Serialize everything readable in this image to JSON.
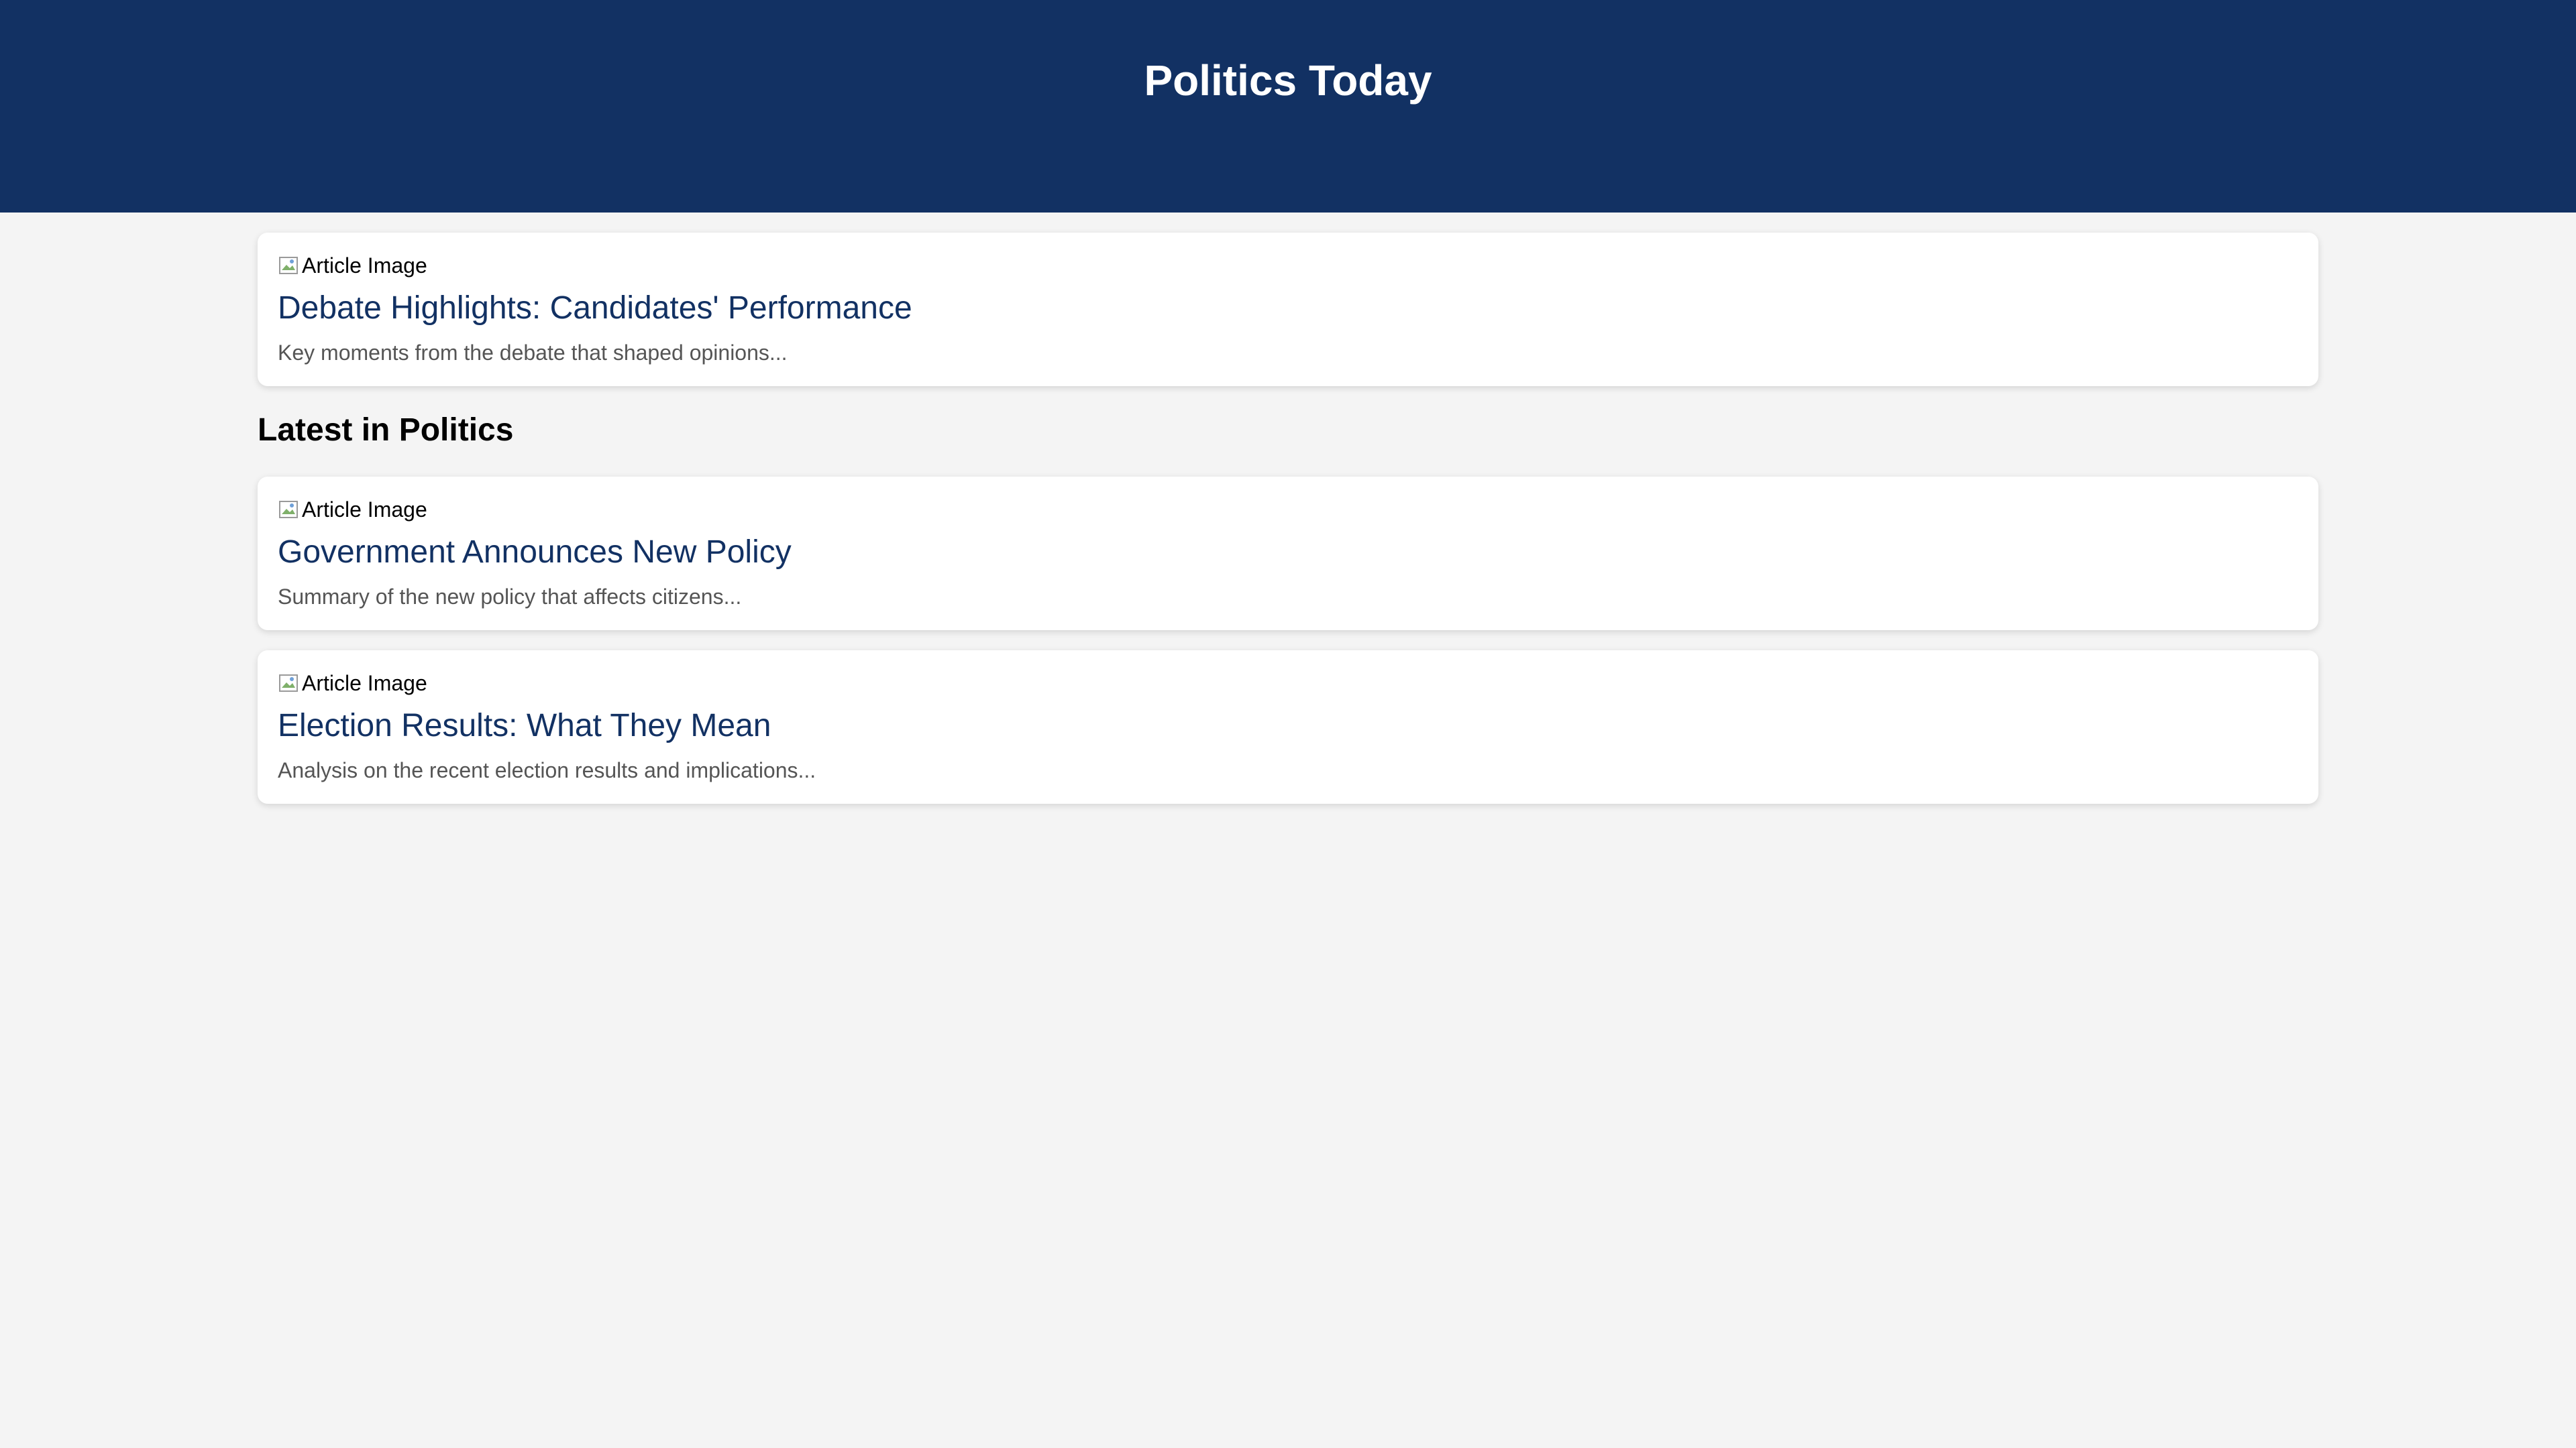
{
  "header": {
    "title": "Politics Today",
    "background_color": "#123163"
  },
  "featured": {
    "image_alt": "Article Image",
    "title": "Debate Highlights: Candidates' Performance",
    "summary": "Key moments from the debate that shaped opinions..."
  },
  "latest": {
    "heading": "Latest in Politics",
    "articles": [
      {
        "image_alt": "Article Image",
        "title": "Government Announces New Policy",
        "summary": "Summary of the new policy that affects citizens..."
      },
      {
        "image_alt": "Article Image",
        "title": "Election Results: What They Mean",
        "summary": "Analysis on the recent election results and implications..."
      }
    ]
  },
  "colors": {
    "accent": "#123163",
    "page_background": "#f4f4f4",
    "card_background": "#ffffff",
    "summary_text": "#555555"
  }
}
